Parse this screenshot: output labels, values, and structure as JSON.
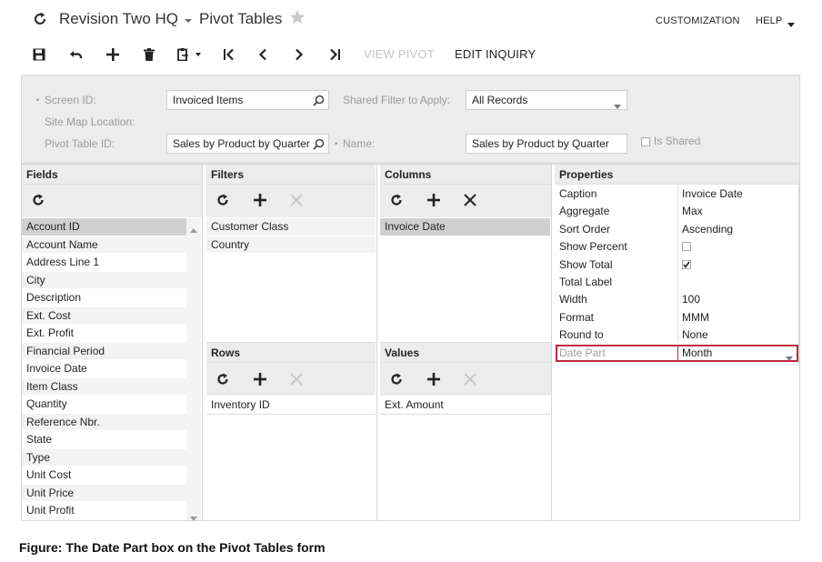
{
  "header": {
    "company": "Revision Two HQ",
    "title": "Pivot Tables",
    "customization": "CUSTOMIZATION",
    "help": "HELP"
  },
  "toolbar": {
    "view_pivot": "VIEW PIVOT",
    "edit_inquiry": "EDIT INQUIRY"
  },
  "form": {
    "screen_id_label": "Screen ID:",
    "screen_id_value": "Invoiced Items",
    "site_map_label": "Site Map Location:",
    "pivot_id_label": "Pivot Table ID:",
    "pivot_id_value": "Sales by Product by Quarter",
    "shared_filter_label": "Shared Filter to Apply:",
    "shared_filter_value": "All Records",
    "name_label": "Name:",
    "name_value": "Sales by Product by Quarter",
    "is_shared_label": "Is Shared",
    "is_shared_checked": false
  },
  "fields": {
    "title": "Fields",
    "items": [
      "Account ID",
      "Account Name",
      "Address Line 1",
      "City",
      "Description",
      "Ext. Cost",
      "Ext. Profit",
      "Financial Period",
      "Invoice Date",
      "Item Class",
      "Quantity",
      "Reference Nbr.",
      "State",
      "Type",
      "Unit Cost",
      "Unit Price",
      "Unit Profit"
    ]
  },
  "filters": {
    "title": "Filters",
    "items": [
      "Customer Class",
      "Country"
    ]
  },
  "columns": {
    "title": "Columns",
    "items": [
      "Invoice Date"
    ]
  },
  "rows": {
    "title": "Rows",
    "items": [
      "Inventory ID"
    ]
  },
  "values": {
    "title": "Values",
    "items": [
      "Ext. Amount"
    ]
  },
  "properties": {
    "title": "Properties",
    "items": [
      {
        "label": "Caption",
        "value": "Invoice Date"
      },
      {
        "label": "Aggregate",
        "value": "Max"
      },
      {
        "label": "Sort Order",
        "value": "Ascending"
      },
      {
        "label": "Show Percent",
        "value": "",
        "checkbox": false
      },
      {
        "label": "Show Total",
        "value": "",
        "checkbox": true
      },
      {
        "label": "Total Label",
        "value": ""
      },
      {
        "label": "Width",
        "value": "100"
      },
      {
        "label": "Format",
        "value": "MMM"
      },
      {
        "label": "Round to",
        "value": "None"
      },
      {
        "label": "Date Part",
        "value": "Month",
        "dropdown": true
      }
    ]
  },
  "caption": "Figure: The Date Part box on the Pivot Tables form",
  "colors": {
    "highlight_border": "#c0283a",
    "selected_row": "#d0d0d0",
    "panel_header": "#ececec"
  }
}
